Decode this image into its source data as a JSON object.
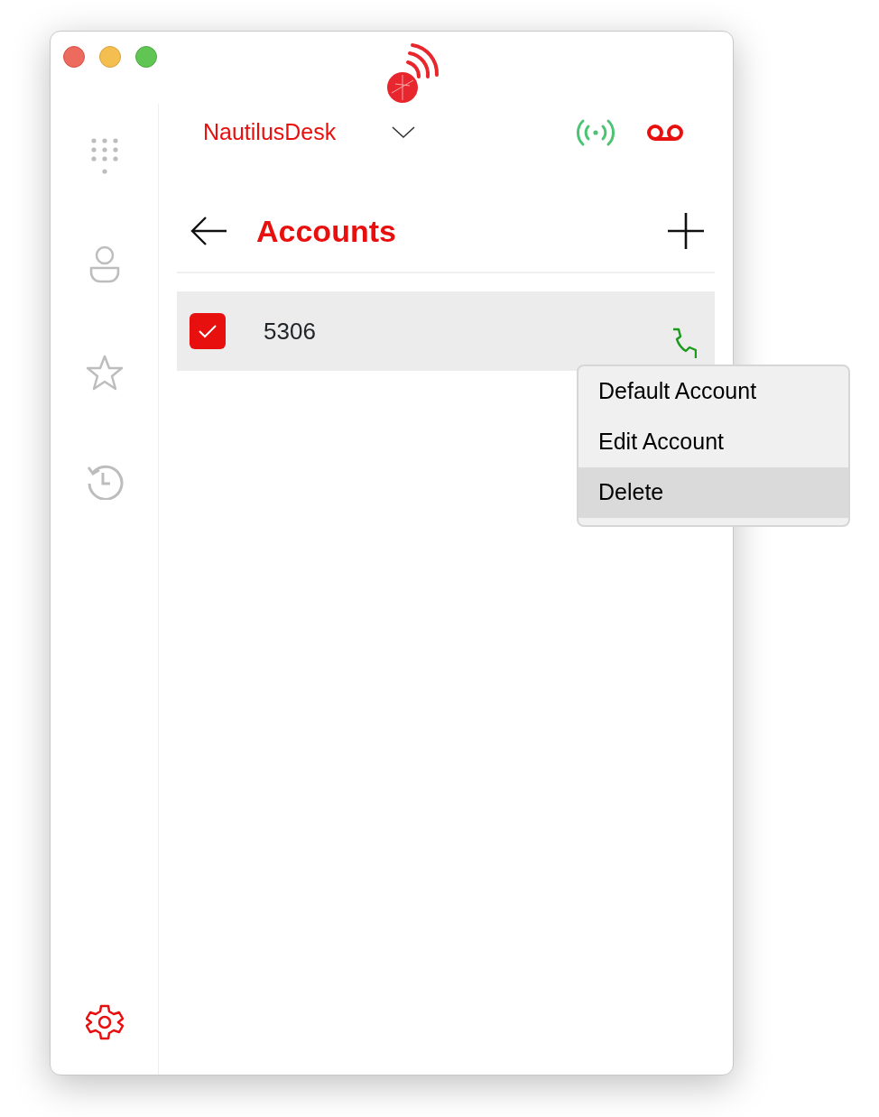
{
  "sidebar": {
    "items": [
      {
        "kind": "dialpad",
        "selected": false
      },
      {
        "kind": "contacts",
        "selected": false
      },
      {
        "kind": "favorites",
        "selected": false
      },
      {
        "kind": "history",
        "selected": false
      },
      {
        "kind": "settings",
        "selected": true
      }
    ]
  },
  "header": {
    "account_name": "NautilusDesk",
    "connected": true
  },
  "page": {
    "title": "Accounts"
  },
  "accounts": [
    {
      "number": "5306",
      "checked": true,
      "selected": true
    }
  ],
  "context_menu": {
    "items": [
      {
        "label": "Default Account",
        "selected": false
      },
      {
        "label": "Edit Account",
        "selected": false
      },
      {
        "label": "Delete",
        "selected": true
      }
    ]
  }
}
